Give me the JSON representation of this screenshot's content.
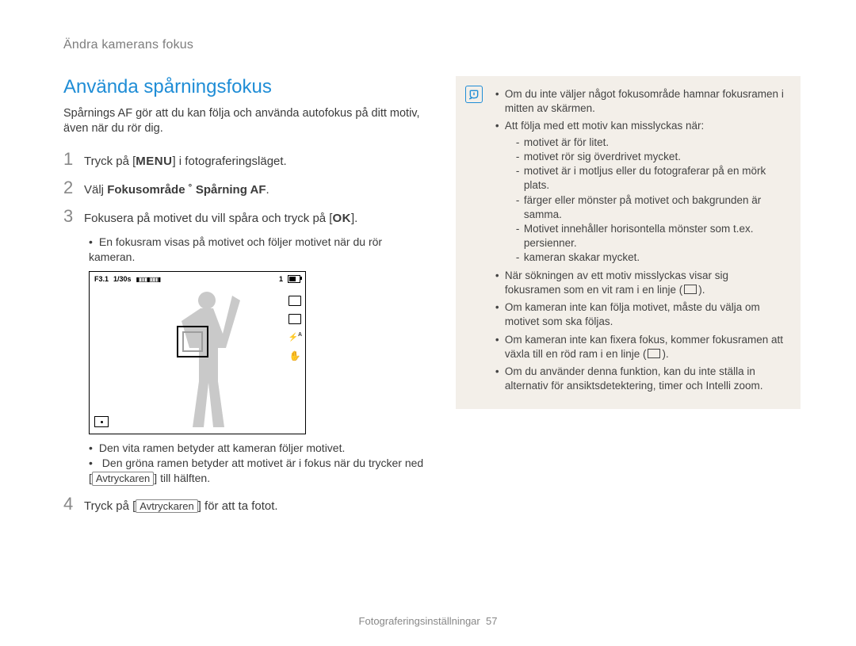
{
  "breadcrumb": "Ändra kamerans fokus",
  "section_title": "Använda spårningsfokus",
  "intro": "Spårnings AF gör att du kan följa och använda autofokus på ditt motiv, även när du rör dig.",
  "steps": {
    "s1": {
      "num": "1",
      "pre": "Tryck på [",
      "btn": "MENU",
      "post": "] i fotograferingsläget."
    },
    "s2": {
      "num": "2",
      "pre": "Välj ",
      "bold": "Fokusområde ˚ Spårning AF",
      "post": "."
    },
    "s3": {
      "num": "3",
      "pre": "Fokusera på motivet du vill spåra och tryck på [",
      "btn": "OK",
      "post": "]."
    },
    "s3_sub1": "En fokusram visas på motivet och följer motivet när du rör kameran.",
    "s3_sub2": "Den vita ramen betyder att kameran följer motivet.",
    "s3_sub3_pre": "Den gröna ramen betyder att motivet är i fokus när du trycker ned [",
    "s3_sub3_btn": "Avtryckaren",
    "s3_sub3_post": "] till hälften.",
    "s4": {
      "num": "4",
      "pre": "Tryck på [",
      "btn": "Avtryckaren",
      "post": "] för att ta fotot."
    }
  },
  "camera": {
    "aperture": "F3.1",
    "shutter": "1/30s",
    "one": "1",
    "flash_label": "A",
    "hand_label": ""
  },
  "note": {
    "n1": "Om du inte väljer något fokusområde hamnar fokusramen i mitten av skärmen.",
    "n2": "Att följa med ett motiv kan misslyckas när:",
    "n2_subs": [
      "motivet är för litet.",
      "motivet rör sig överdrivet mycket.",
      "motivet är i motljus eller du fotograferar på en mörk plats.",
      "färger eller mönster på motivet och bakgrunden är samma.",
      "Motivet innehåller horisontella mönster som t.ex. persienner.",
      "kameran skakar mycket."
    ],
    "n3_pre": "När sökningen av ett motiv misslyckas visar sig fokusramen som en vit ram i en linje (",
    "n3_post": ").",
    "n4": "Om kameran inte kan följa motivet, måste du välja om motivet som ska följas.",
    "n5_pre": "Om kameran inte kan fixera fokus, kommer fokusramen att växla till en röd ram i en linje (",
    "n5_post": ").",
    "n6": "Om du använder denna funktion, kan du inte ställa in alternativ för ansiktsdetektering, timer och Intelli zoom."
  },
  "footer": {
    "label": "Fotograferingsinställningar",
    "page": "57"
  }
}
